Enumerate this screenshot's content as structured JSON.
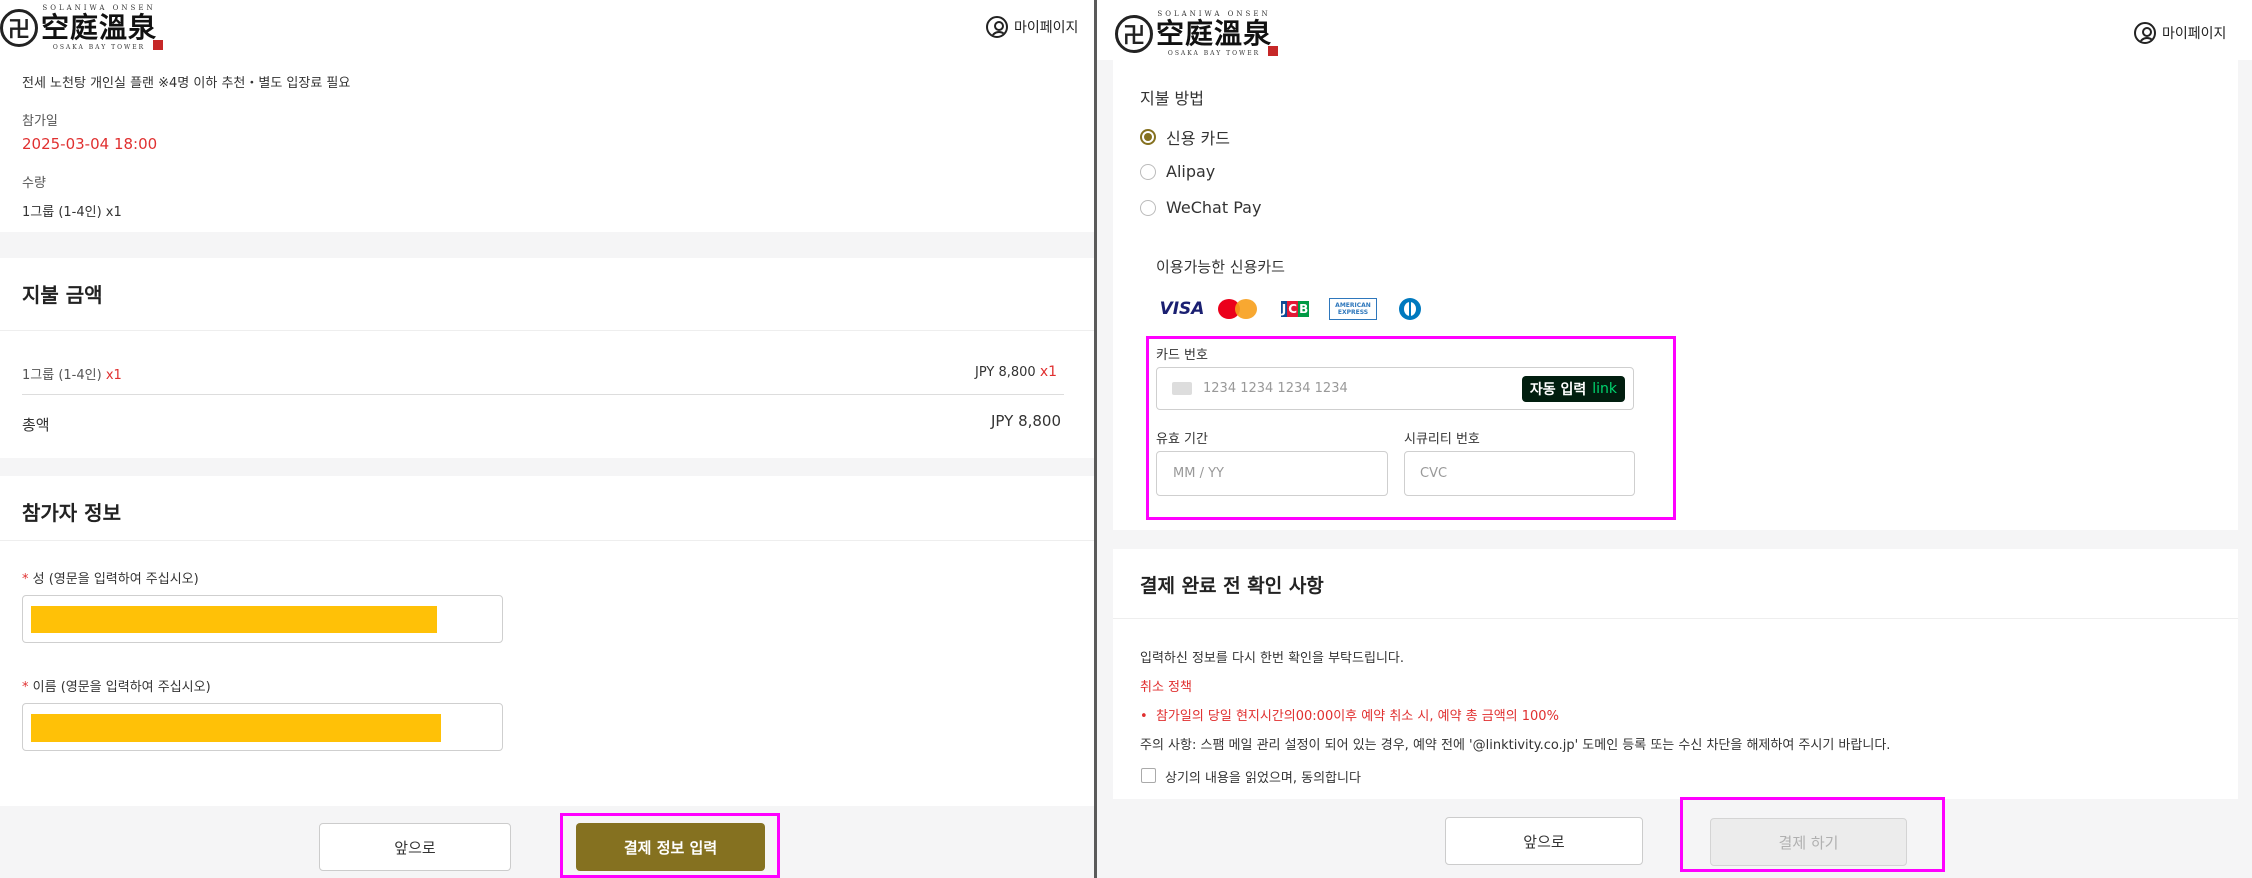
{
  "brand": {
    "top_text": "SOLANIWA ONSEN",
    "name": "空庭溫泉",
    "sub_text": "OSAKA BAY TOWER"
  },
  "header": {
    "mypage_label": "마이페이지"
  },
  "left": {
    "plan_text": "전세 노천탕 개인실 플랜 ※4명 이하 추천・별도 입장료 필요",
    "date_label": "참가일",
    "date_value": "2025-03-04 18:00",
    "qty_label": "수량",
    "qty_value": "1그룹 (1-4인) x1",
    "payment_title": "지불 금액",
    "line_item": {
      "name": "1그룹 (1-4인)",
      "multiplier": "x1",
      "price": "JPY 8,800",
      "price_multiplier": "x1"
    },
    "total_label": "총액",
    "total_value": "JPY 8,800",
    "participant_title": "참가자 정보",
    "last_name_label": "성 (영문을 입력하여 주십시오)",
    "first_name_label": "이름 (영문을 입력하여 주십시오)",
    "required_mark": "*",
    "back_button": "앞으로",
    "next_button": "결제 정보 입력"
  },
  "right": {
    "payment_method_title": "지불 방법",
    "methods": [
      {
        "label": "신용 카드",
        "selected": true
      },
      {
        "label": "Alipay",
        "selected": false
      },
      {
        "label": "WeChat Pay",
        "selected": false
      }
    ],
    "available_cards_label": "이용가능한 신용카드",
    "card_brands": [
      "VISA",
      "MasterCard",
      "JCB",
      "AMERICAN EXPRESS",
      "Diners Club"
    ],
    "card_number_label": "카드 번호",
    "card_number_placeholder": "1234 1234 1234 1234",
    "autofill_label": "자동 입력",
    "autofill_link": "link",
    "expiry_label": "유효 기간",
    "expiry_placeholder": "MM / YY",
    "cvc_label": "시큐리티 번호",
    "cvc_placeholder": "CVC",
    "confirm_title": "결제 완료 전 확인 사항",
    "confirm_text": "입력하신 정보를 다시 한번 확인을 부탁드립니다.",
    "cancel_policy_title": "취소 정책",
    "cancel_policy_item": "참가일의 당일 현지시간의00:00이후 예약 취소 시, 예약 총 금액의 100%",
    "notice": "주의 사항: 스팸 메일 관리 설정이 되어 있는 경우, 예약 전에 '@linktivity.co.jp' 도메인 등록 또는 수신 차단을 해제하여 주시기 바랍니다.",
    "agree_label": "상기의 내용을 읽었으며, 동의합니다",
    "back_button": "앞으로",
    "pay_button": "결제 하기"
  },
  "colors": {
    "accent_gold": "#857120",
    "highlight_magenta": "#ff00ff",
    "error_red": "#e03030",
    "redaction_yellow": "#ffc107",
    "link_green": "#00d66f"
  }
}
